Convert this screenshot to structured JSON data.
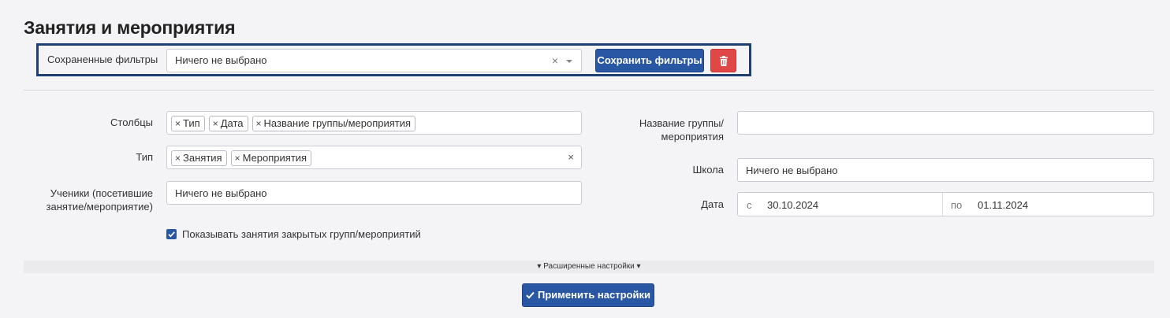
{
  "page": {
    "title": "Занятия и мероприятия"
  },
  "saved_filters": {
    "label": "Сохраненные фильтры",
    "value": "Ничего не выбрано",
    "save_button": "Сохранить фильтры",
    "delete_icon": "trash-icon"
  },
  "filters": {
    "columns": {
      "label": "Столбцы",
      "tags": [
        "Тип",
        "Дата",
        "Название группы/мероприятия"
      ]
    },
    "type": {
      "label": "Тип",
      "tags": [
        "Занятия",
        "Мероприятия"
      ]
    },
    "students": {
      "label_line1": "Ученики (посетившие",
      "label_line2": "занятие/мероприятие)",
      "placeholder": "Ничего не выбрано"
    },
    "show_closed": {
      "label": "Показывать занятия закрытых групп/мероприятий",
      "checked": true
    },
    "group_name": {
      "label_line1": "Название группы/",
      "label_line2": "мероприятия",
      "value": ""
    },
    "school": {
      "label": "Школа",
      "placeholder": "Ничего не выбрано"
    },
    "date": {
      "label": "Дата",
      "from_label": "с",
      "from_value": "30.10.2024",
      "to_label": "по",
      "to_value": "01.11.2024"
    }
  },
  "advanced": {
    "label": "Расширенные настройки"
  },
  "apply_button": {
    "label": "Применить настройки"
  },
  "colors": {
    "primary": "#2957a4",
    "danger": "#e04848",
    "frame": "#1d3f72"
  }
}
